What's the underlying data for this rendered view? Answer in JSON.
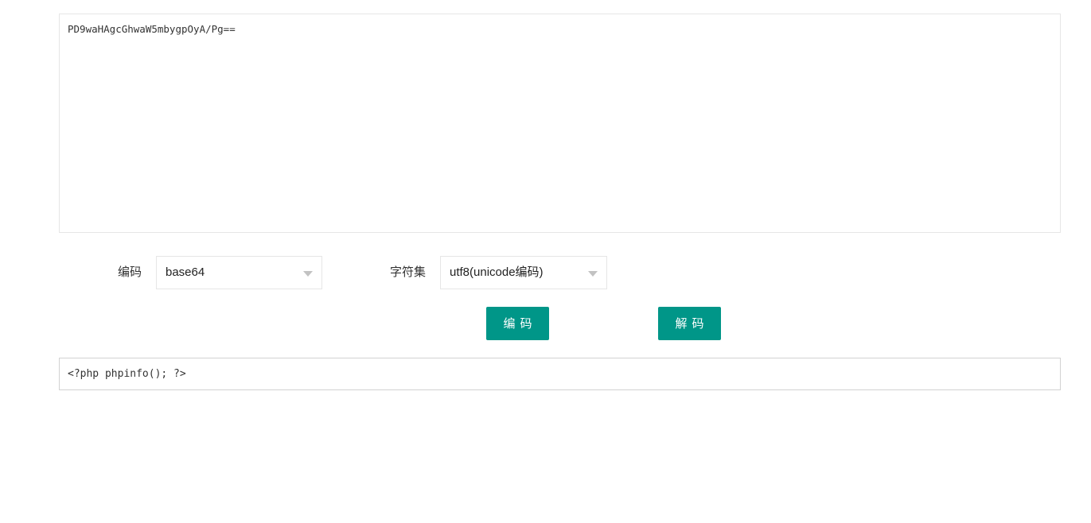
{
  "input": {
    "value": "PD9waHAgcGhwaW5mbygpOyA/Pg=="
  },
  "encoding": {
    "label": "编码",
    "selected": "base64"
  },
  "charset": {
    "label": "字符集",
    "selected": "utf8(unicode编码)"
  },
  "buttons": {
    "encode": "编码",
    "decode": "解码"
  },
  "output": {
    "value": "<?php phpinfo(); ?>"
  },
  "colors": {
    "primary": "#009688",
    "border": "#e6e6e6",
    "arrow": "#c2c2c2"
  }
}
